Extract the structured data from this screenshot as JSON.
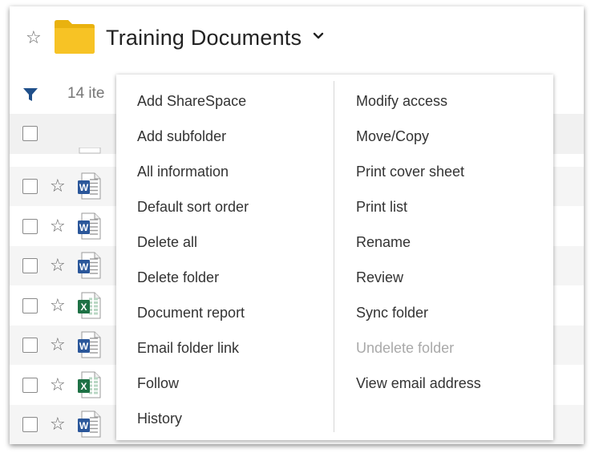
{
  "header": {
    "title": "Training Documents",
    "item_count_partial": "14 ite"
  },
  "colors": {
    "folder": "#f7c325",
    "filter": "#1f4f8a",
    "word": "#2b579a",
    "excel": "#1e7145"
  },
  "rows": [
    {
      "type": "word"
    },
    {
      "type": "word"
    },
    {
      "type": "word"
    },
    {
      "type": "excel"
    },
    {
      "type": "word"
    },
    {
      "type": "excel"
    },
    {
      "type": "word"
    }
  ],
  "menu": {
    "left": [
      {
        "label": "Add ShareSpace"
      },
      {
        "label": "Add subfolder"
      },
      {
        "label": "All information"
      },
      {
        "label": "Default sort order"
      },
      {
        "label": "Delete all"
      },
      {
        "label": "Delete folder"
      },
      {
        "label": "Document report"
      },
      {
        "label": "Email folder link"
      },
      {
        "label": "Follow"
      },
      {
        "label": "History"
      }
    ],
    "right": [
      {
        "label": "Modify access"
      },
      {
        "label": "Move/Copy"
      },
      {
        "label": "Print cover sheet"
      },
      {
        "label": "Print list"
      },
      {
        "label": "Rename"
      },
      {
        "label": "Review"
      },
      {
        "label": "Sync folder"
      },
      {
        "label": "Undelete folder",
        "disabled": true
      },
      {
        "label": "View email address"
      }
    ]
  }
}
